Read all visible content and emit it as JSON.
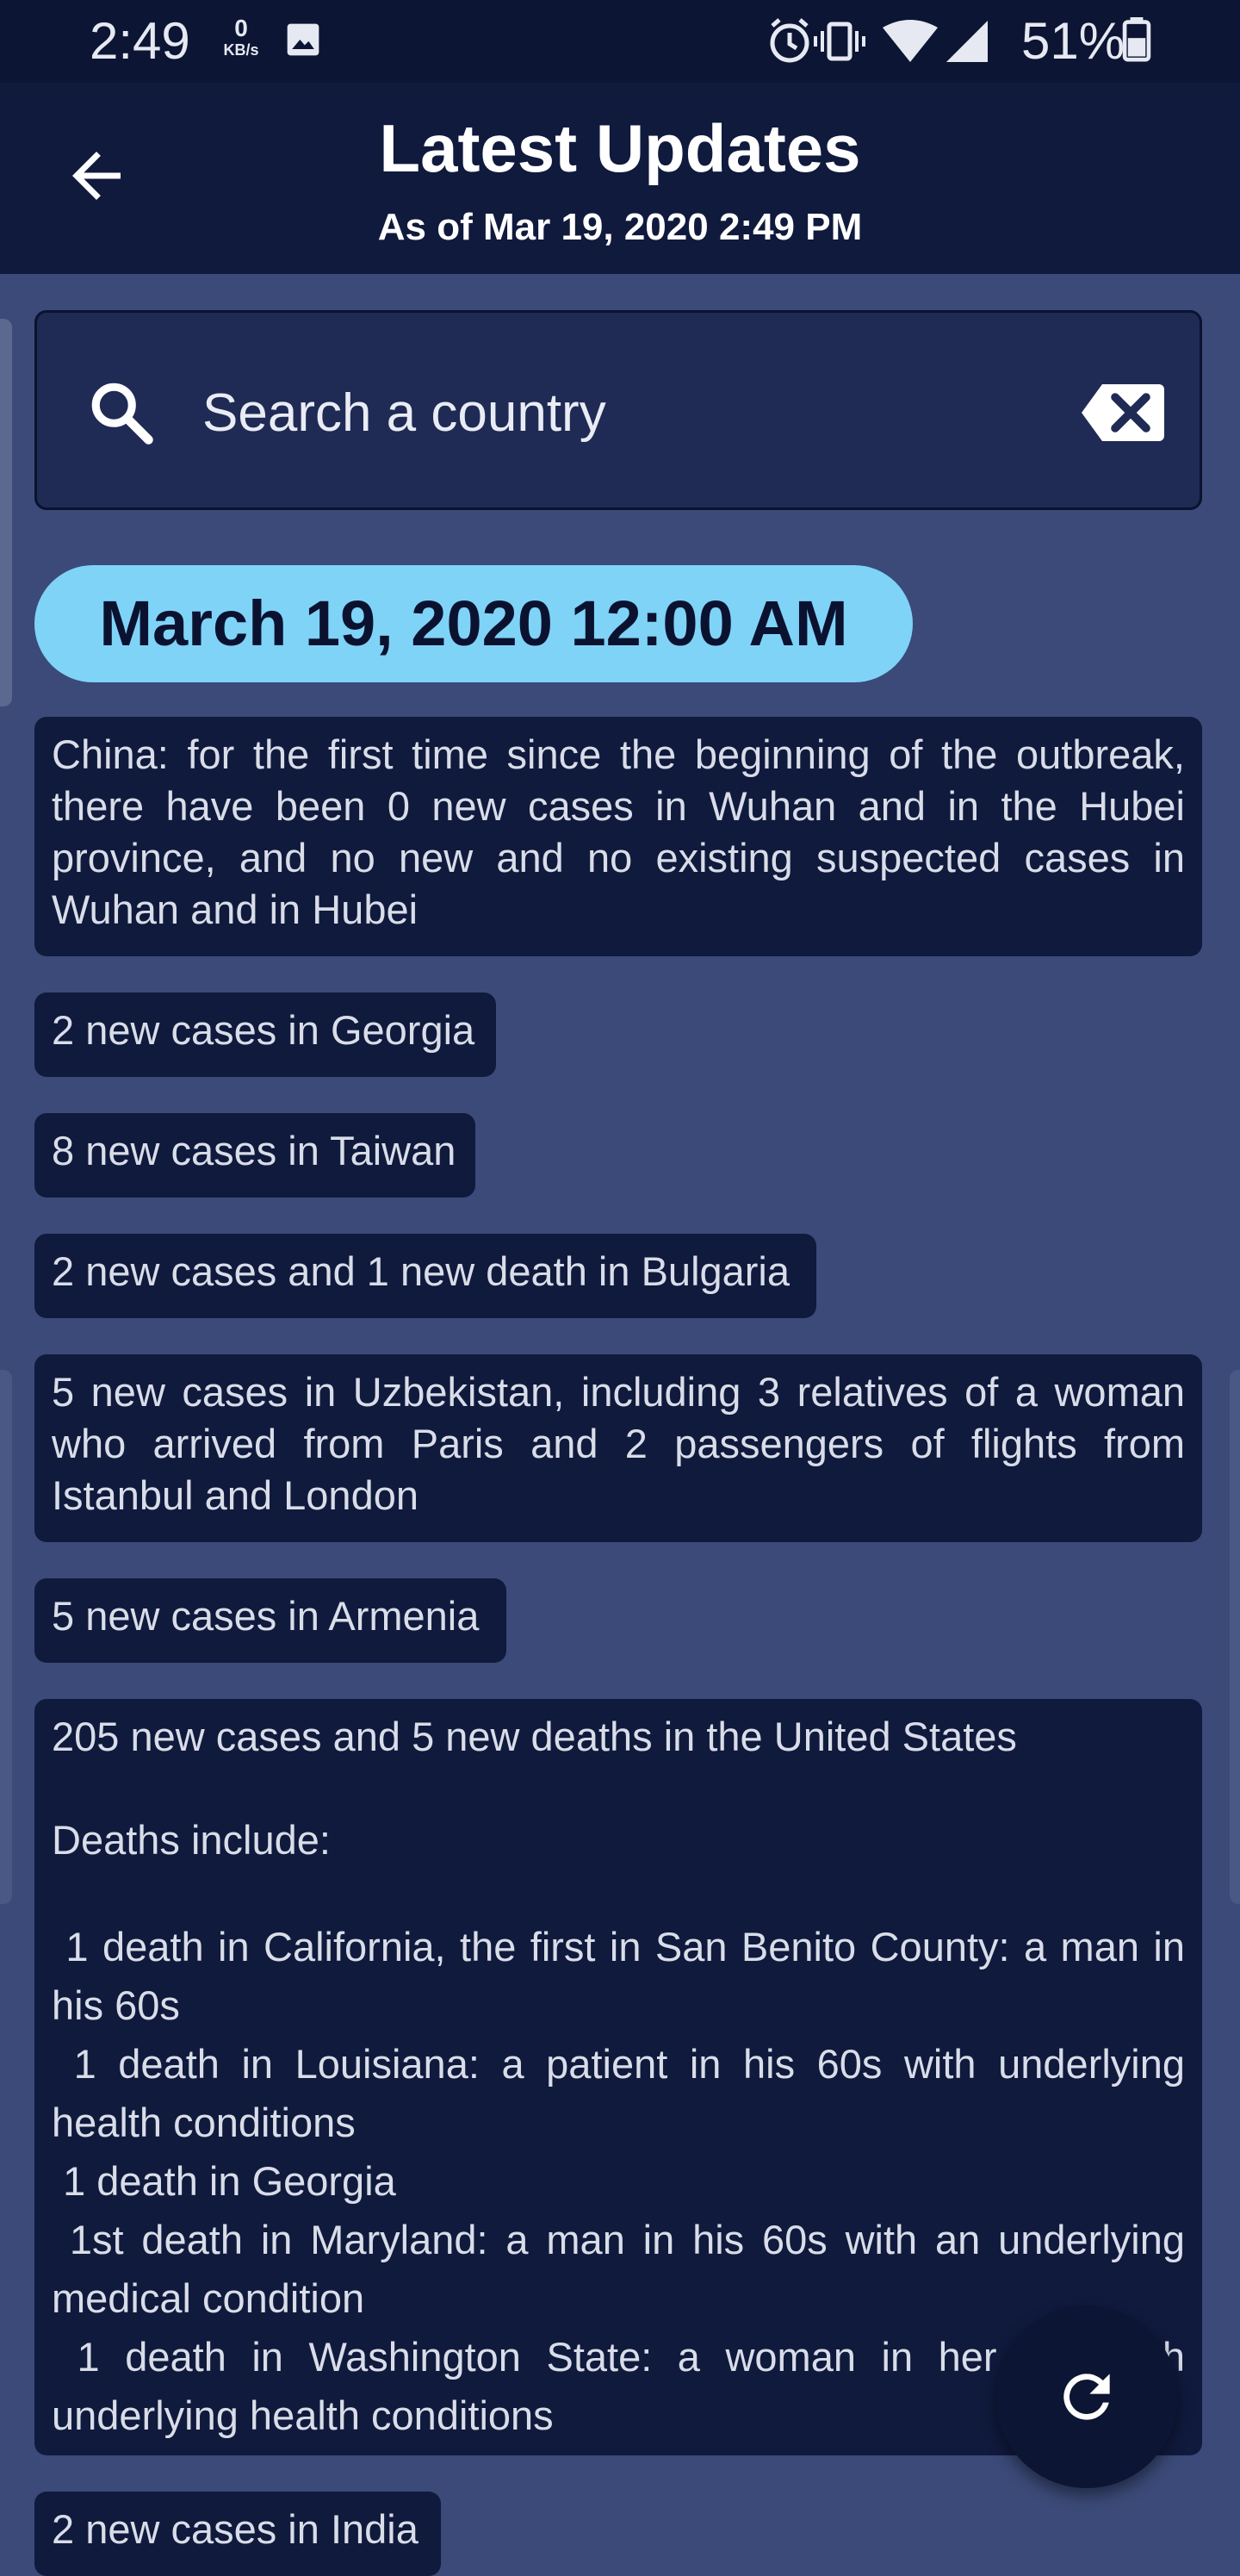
{
  "status_bar": {
    "time": "2:49",
    "net_speed_value": "0",
    "net_speed_unit": "KB/s",
    "battery_percent": "51%",
    "icons": [
      "image-icon",
      "alarm-icon",
      "vibrate-icon",
      "wifi-icon",
      "signal-icon",
      "battery-icon"
    ]
  },
  "header": {
    "title": "Latest Updates",
    "subtitle": "As of Mar 19, 2020 2:49 PM",
    "back_icon": "arrow-left-icon"
  },
  "search": {
    "placeholder": "Search a country",
    "value": "",
    "search_icon": "search-icon",
    "clear_icon": "backspace-clear-icon"
  },
  "date_section": {
    "label": "March 19, 2020 12:00 AM",
    "accent_color": "#7fd3f7"
  },
  "updates": [
    {
      "text": "China: for the first time since the beginning of the outbreak, there have been 0 new cases in Wuhan and in the Hubei province, and no new and no existing suspected cases in Wuhan and in Hubei"
    },
    {
      "text": "2 new cases in Georgia"
    },
    {
      "text": "8 new cases in Taiwan"
    },
    {
      "text": "2 new cases and 1 new death in Bulgaria"
    },
    {
      "text": "5 new cases in Uzbekistan, including 3 relatives of a woman who arrived from Paris and 2 passengers of flights from Istanbul and London"
    },
    {
      "text": "5 new cases in Armenia"
    },
    {
      "line1": "205 new cases and 5 new deaths in the United States",
      "line2": "Deaths include:",
      "line3": " 1 death in California, the first in San Benito County: a man in his 60s",
      "line4": " 1 death in Louisiana: a patient in his 60s with underlying health conditions",
      "line5": " 1 death in Georgia",
      "line6": " 1st death in Maryland: a man in his 60s with an underlying medical condition",
      "line7": " 1 death in Washington State: a woman in her 80s with underlying health conditions"
    },
    {
      "text": "2 new cases in India"
    }
  ],
  "fab": {
    "icon": "refresh-icon"
  },
  "colors": {
    "background": "#3b4a78",
    "card": "#101a3d",
    "header": "#101a3d",
    "status_bar": "#0c1533"
  }
}
